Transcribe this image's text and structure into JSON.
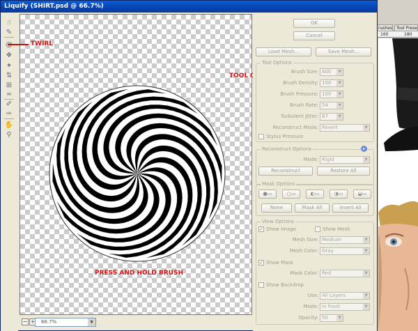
{
  "window": {
    "title": "Liquify (SHIRT.psd @ 66.7%)"
  },
  "background_app": {
    "tabs": [
      "rushes",
      "Tool Presets"
    ],
    "ruler": [
      "160",
      "180"
    ]
  },
  "tools": [
    "forward-warp-tool",
    "reconstruct-tool",
    "twirl-tool",
    "pucker-tool",
    "bloat-tool",
    "push-left-tool",
    "mirror-tool",
    "turbulence-tool",
    "freeze-mask-tool",
    "thaw-mask-tool",
    "hand-tool",
    "zoom-tool"
  ],
  "annotations": {
    "twirl": "TWIRL",
    "tool_options": "TOOL OPTIONS",
    "press_hold": "PRESS AND HOLD BRUSH"
  },
  "zoom": {
    "value": "66.7%"
  },
  "buttons": {
    "ok": "OK",
    "cancel": "Cancel",
    "load_mesh": "Load Mesh...",
    "save_mesh": "Save Mesh...",
    "reconstruct": "Reconstruct",
    "restore_all": "Restore All",
    "none": "None",
    "mask_all": "Mask All",
    "invert_all": "Invert All"
  },
  "tool_options": {
    "title": "Tool Options",
    "brush_size": {
      "label": "Brush Size:",
      "value": "600"
    },
    "brush_density": {
      "label": "Brush Density:",
      "value": "100"
    },
    "brush_pressure": {
      "label": "Brush Pressure:",
      "value": "100"
    },
    "brush_rate": {
      "label": "Brush Rate:",
      "value": "54"
    },
    "turbulent_jitter": {
      "label": "Turbulent Jitter:",
      "value": "87"
    },
    "reconstruct_mode": {
      "label": "Reconstruct Mode:",
      "value": "Revert"
    },
    "stylus_pressure": {
      "label": "Stylus Pressure",
      "checked": false
    }
  },
  "reconstruct_options": {
    "title": "Reconstruct Options",
    "mode": {
      "label": "Mode:",
      "value": "Rigid"
    }
  },
  "mask_options": {
    "title": "Mask Options"
  },
  "view_options": {
    "title": "View Options",
    "show_image": {
      "label": "Show Image",
      "checked": true
    },
    "show_mesh": {
      "label": "Show Mesh",
      "checked": false
    },
    "mesh_size": {
      "label": "Mesh Size:",
      "value": "Medium"
    },
    "mesh_color": {
      "label": "Mesh Color:",
      "value": "Gray"
    },
    "show_mask": {
      "label": "Show Mask",
      "checked": true
    },
    "mask_color": {
      "label": "Mask Color:",
      "value": "Red"
    },
    "show_backdrop": {
      "label": "Show Backdrop",
      "checked": false
    },
    "use": {
      "label": "Use:",
      "value": "All Layers"
    },
    "mode": {
      "label": "Mode:",
      "value": "In Front"
    },
    "opacity": {
      "label": "Opacity:",
      "value": "50"
    }
  },
  "colors": {
    "title_bar": "#0842b0",
    "dialog_bg": "#ece9d8",
    "annotation": "#d01010"
  }
}
